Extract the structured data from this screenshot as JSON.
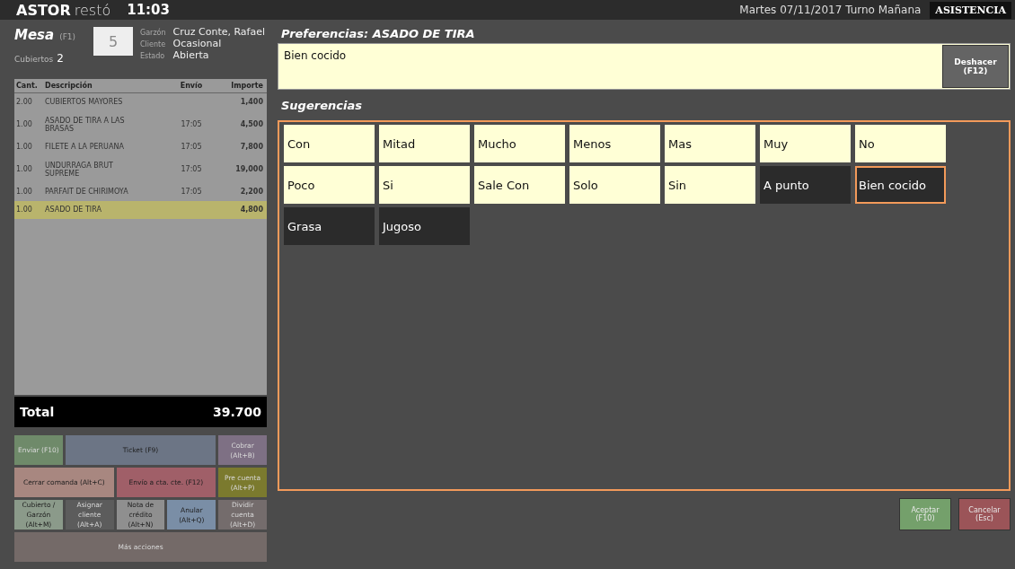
{
  "top_bar": {
    "logo_bold": "ASTOR",
    "logo_light": "restó",
    "time": "11:03",
    "date_shift": "Martes 07/11/2017 Turno Mañana",
    "assist_button": "ASISTENCIA"
  },
  "table_info": {
    "title": "Mesa",
    "title_key": "(F1)",
    "covers_label": "Cubiertos",
    "covers": "2",
    "number": "5",
    "fields": [
      {
        "label": "Garzón",
        "value": "Cruz Conte, Rafael"
      },
      {
        "label": "Cliente",
        "value": "Ocasional"
      },
      {
        "label": "Estado",
        "value": "Abierta"
      }
    ]
  },
  "order": {
    "columns": [
      "Cant.",
      "Descripción",
      "Envío",
      "Importe"
    ],
    "rows": [
      {
        "qty": "2.00",
        "description": "CUBIERTOS MAYORES",
        "sent": "",
        "amount": "1,400",
        "selected": false
      },
      {
        "qty": "1.00",
        "description": "ASADO DE TIRA A LAS\nBRASAS",
        "sent": "17:05",
        "amount": "4,500",
        "selected": false
      },
      {
        "qty": "1.00",
        "description": "FILETE A LA PERUANA",
        "sent": "17:05",
        "amount": "7,800",
        "selected": false
      },
      {
        "qty": "1.00",
        "description": "UNDURRAGA BRUT\nSUPREME",
        "sent": "17:05",
        "amount": "19,000",
        "selected": false
      },
      {
        "qty": "1.00",
        "description": "PARFAIT DE CHIRIMOYA",
        "sent": "17:05",
        "amount": "2,200",
        "selected": false
      },
      {
        "qty": "1.00",
        "description": "ASADO DE TIRA",
        "sent": "",
        "amount": "4,800",
        "selected": true
      }
    ],
    "total_label": "Total",
    "total": "39.700"
  },
  "actions": [
    {
      "label": "Enviar (F10)",
      "kind": "single",
      "color": "#6f8a6a",
      "disabled": true
    },
    {
      "label": "Ticket (F9)",
      "kind": "triple",
      "color": "#6c7585",
      "disabled": false
    },
    {
      "label": "Cobrar\n(Alt+B)",
      "kind": "single",
      "color": "#7e7084",
      "disabled": true
    },
    {
      "label": "Cerrar comanda (Alt+C)",
      "kind": "double",
      "color": "#a88780",
      "disabled": false
    },
    {
      "label": "Envío a cta. cte. (F12)",
      "kind": "double",
      "color": "#a05f68",
      "disabled": false
    },
    {
      "label": "Pre cuenta\n(Alt+P)",
      "kind": "single",
      "color": "#7b7a2e",
      "disabled": true
    },
    {
      "label": "Cubierto /\nGarzón\n(Alt+M)",
      "kind": "single",
      "color": "#8b9a8a",
      "disabled": false
    },
    {
      "label": "Asignar\ncliente\n(Alt+A)",
      "kind": "single",
      "color": "#5c5c5c",
      "disabled": true
    },
    {
      "label": "Nota de\ncrédito\n(Alt+N)",
      "kind": "single",
      "color": "#8f8f8f",
      "disabled": false
    },
    {
      "label": "Anular\n(Alt+Q)",
      "kind": "single",
      "color": "#7a8ea6",
      "disabled": false
    },
    {
      "label": "Dividir\ncuenta\n(Alt+D)",
      "kind": "single",
      "color": "#746c6c",
      "disabled": true
    },
    {
      "label": "Más acciones",
      "kind": "full",
      "color": "#746a68",
      "disabled": true
    }
  ],
  "preferences": {
    "title": "Preferencias: ASADO DE TIRA",
    "value": "Bien cocido",
    "undo_button": "Deshacer\n(F12)"
  },
  "suggestions": {
    "title": "Sugerencias",
    "items": [
      {
        "label": "Con",
        "kind": "modifier",
        "selected": false
      },
      {
        "label": "Mitad",
        "kind": "modifier",
        "selected": false
      },
      {
        "label": "Mucho",
        "kind": "modifier",
        "selected": false
      },
      {
        "label": "Menos",
        "kind": "modifier",
        "selected": false
      },
      {
        "label": "Mas",
        "kind": "modifier",
        "selected": false
      },
      {
        "label": "Muy",
        "kind": "modifier",
        "selected": false
      },
      {
        "label": "No",
        "kind": "modifier",
        "selected": false
      },
      {
        "label": "Poco",
        "kind": "modifier",
        "selected": false
      },
      {
        "label": "Si",
        "kind": "modifier",
        "selected": false
      },
      {
        "label": "Sale Con",
        "kind": "modifier",
        "selected": false
      },
      {
        "label": "Solo",
        "kind": "modifier",
        "selected": false
      },
      {
        "label": "Sin",
        "kind": "modifier",
        "selected": false
      },
      {
        "label": "A punto",
        "kind": "option",
        "selected": false
      },
      {
        "label": "Bien cocido",
        "kind": "option",
        "selected": true
      },
      {
        "label": "Grasa",
        "kind": "option",
        "selected": false
      },
      {
        "label": "Jugoso",
        "kind": "option",
        "selected": false
      }
    ]
  },
  "footer_buttons": [
    {
      "label": "Aceptar\n(F10)",
      "kind": "accept"
    },
    {
      "label": "Cancelar\n(Esc)",
      "kind": "cancel"
    }
  ]
}
